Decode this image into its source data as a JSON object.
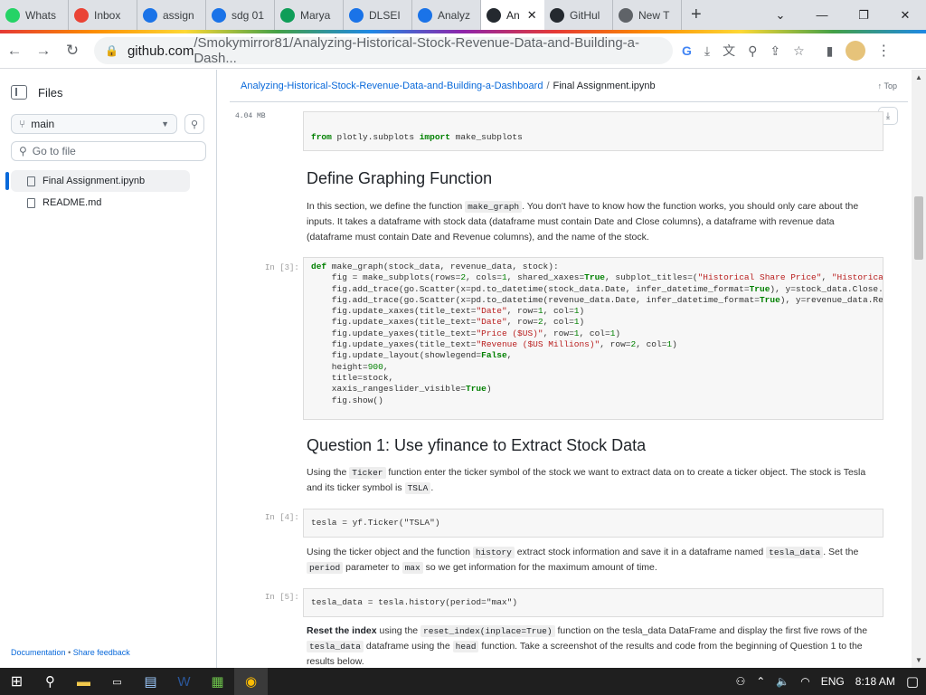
{
  "browser": {
    "tabs": [
      {
        "label": "Whats",
        "icon": "whatsapp-icon",
        "color": "#25d366"
      },
      {
        "label": "Inbox",
        "icon": "gmail-icon",
        "color": "#ea4335"
      },
      {
        "label": "assign",
        "icon": "chatgpt-icon",
        "color": "#1a73e8"
      },
      {
        "label": "sdg 01",
        "icon": "chatgpt-icon",
        "color": "#1a73e8"
      },
      {
        "label": "Marya",
        "icon": "sheets-icon",
        "color": "#0f9d58"
      },
      {
        "label": "DLSEI",
        "icon": "chatgpt-icon",
        "color": "#1a73e8"
      },
      {
        "label": "Analyz",
        "icon": "chatgpt-icon",
        "color": "#1a73e8"
      },
      {
        "label": "An",
        "icon": "github-icon",
        "color": "#24292f",
        "active": true
      },
      {
        "label": "GitHul",
        "icon": "github-icon",
        "color": "#24292f"
      },
      {
        "label": "New T",
        "icon": "chrome-icon",
        "color": "#5f6368"
      }
    ],
    "new_tab_symbol": "+",
    "url_host": "github.com",
    "url_path": "/Smokymirror81/Analyzing-Historical-Stock-Revenue-Data-and-Building-a-Dash..."
  },
  "sidebar": {
    "title": "Files",
    "branch": "main",
    "goto_placeholder": "Go to file",
    "files": [
      {
        "name": "Final Assignment.ipynb",
        "selected": true
      },
      {
        "name": "README.md",
        "selected": false
      }
    ],
    "footer_docs": "Documentation",
    "footer_sep": "•",
    "footer_feedback": "Share feedback"
  },
  "header": {
    "repo": "Analyzing-Historical-Stock-Revenue-Data-and-Building-a-Dashboard",
    "separator": "/",
    "file": "Final Assignment.ipynb",
    "top_label": "Top",
    "file_size": "4.04 MB"
  },
  "notebook": {
    "cell0_code": "from plotly.subplots import make_subplots",
    "section1_title": "Define Graphing Function",
    "section1_para_a": "In this section, we define the function ",
    "section1_para_code": "make_graph",
    "section1_para_b": ". You don't have to know how the function works, you should only care about the inputs. It takes a dataframe with stock data (dataframe must contain Date and Close columns), a dataframe with revenue data (dataframe must contain Date and Revenue columns), and the name of the stock.",
    "cell3_prompt": "In [3]:",
    "cell4_prompt": "In [4]:",
    "cell5_prompt": "In [5]:",
    "section2_title": "Question 1: Use yfinance to Extract Stock Data",
    "q1_a": "Using the ",
    "q1_code1": "Ticker",
    "q1_b": " function enter the ticker symbol of the stock we want to extract data on to create a ticker object. The stock is Tesla and its ticker symbol is ",
    "q1_code2": "TSLA",
    "q1_c": ".",
    "cell4_code": "tesla = yf.Ticker(\"TSLA\")",
    "q2_a": "Using the ticker object and the function ",
    "q2_code1": "history",
    "q2_b": " extract stock information and save it in a dataframe named ",
    "q2_code2": "tesla_data",
    "q2_c": ". Set the ",
    "q2_code3": "period",
    "q2_d": " parameter to ",
    "q2_code4": "max",
    "q2_e": " so we get information for the maximum amount of time.",
    "cell5_code": "tesla_data = tesla.history(period=\"max\")",
    "q3_bold": "Reset the index",
    "q3_a": " using the ",
    "q3_code1": "reset_index(inplace=True)",
    "q3_b": " function on the tesla_data DataFrame and display the first five rows of the ",
    "q3_code2": "tesla_data",
    "q3_c": " dataframe using the ",
    "q3_code3": "head",
    "q3_d": " function. Take a screenshot of the results and code from the beginning of Question 1 to the results below."
  },
  "taskbar": {
    "lang": "ENG",
    "time": "8:18 AM"
  }
}
